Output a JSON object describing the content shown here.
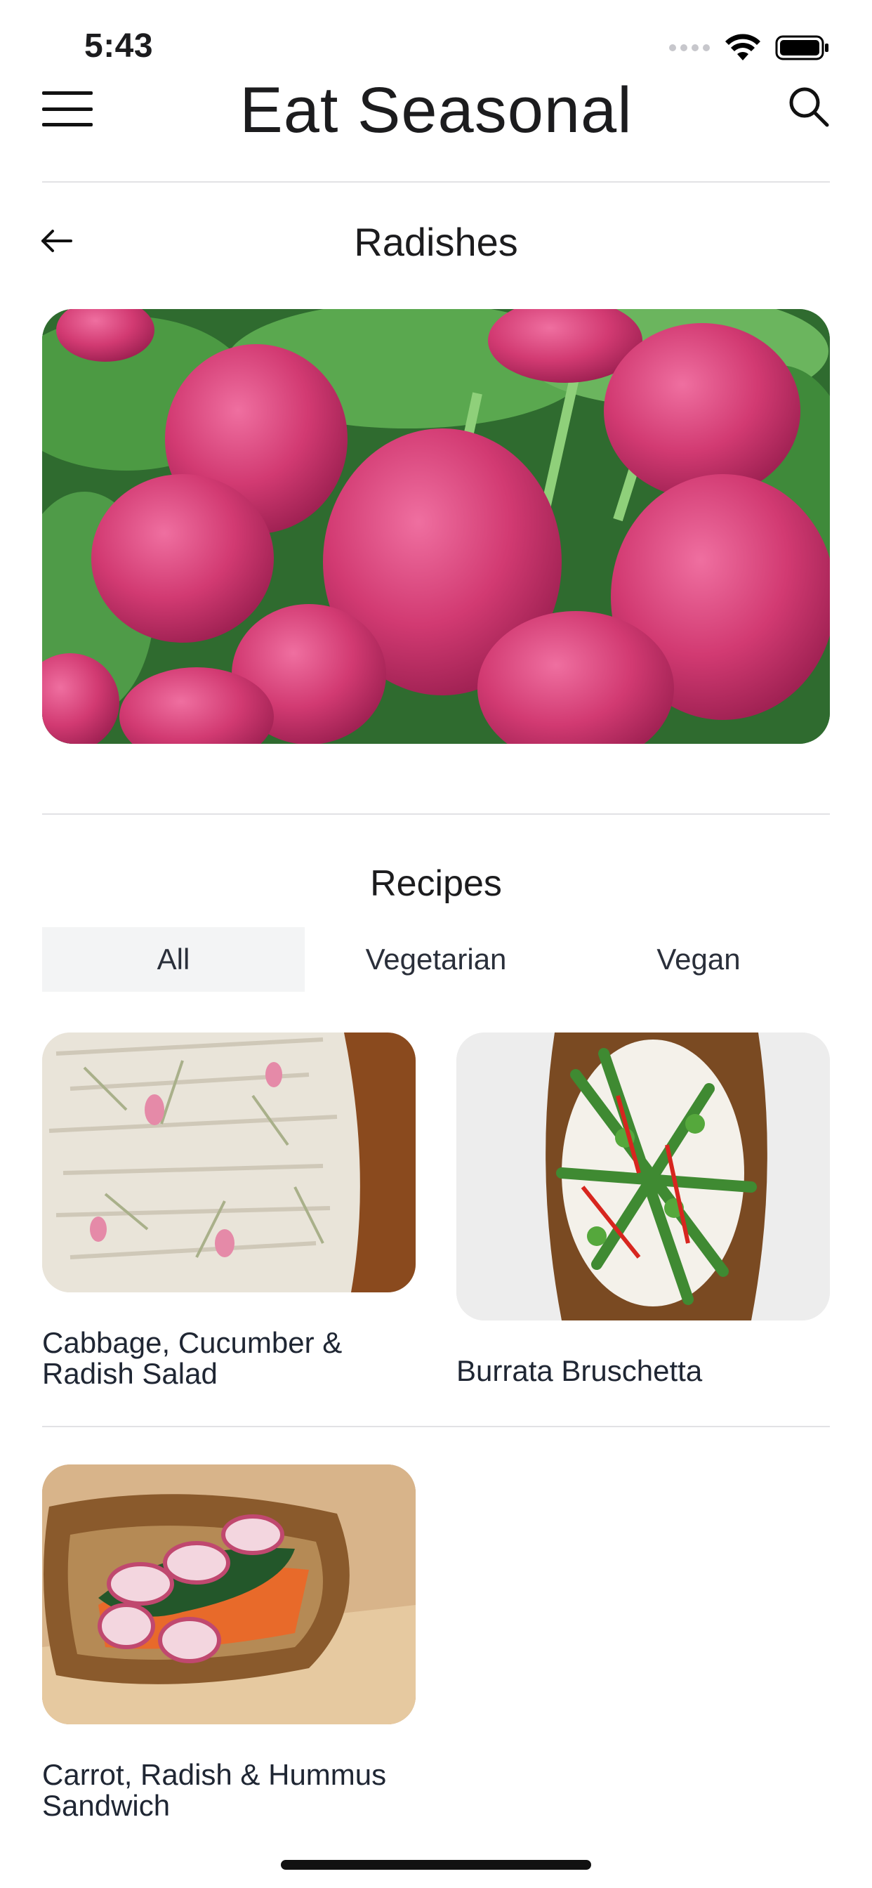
{
  "status_bar": {
    "time": "5:43"
  },
  "header": {
    "title": "Eat Seasonal"
  },
  "page": {
    "title": "Radishes"
  },
  "recipes_section": {
    "title": "Recipes",
    "tabs": [
      {
        "label": "All",
        "active": true
      },
      {
        "label": "Vegetarian",
        "active": false
      },
      {
        "label": "Vegan",
        "active": false
      }
    ],
    "items": [
      {
        "title_line1": "Cabbage, Cucumber &",
        "title_line2": "Radish Salad"
      },
      {
        "title_line1": "Burrata Bruschetta",
        "title_line2": ""
      },
      {
        "title_line1": "Carrot, Radish & Hummus",
        "title_line2": "Sandwich"
      }
    ]
  },
  "icons": {
    "menu": "hamburger-menu-icon",
    "search": "search-icon",
    "back": "arrow-left-icon"
  },
  "colors": {
    "background": "#ffffff",
    "divider": "#e2e2e5",
    "active_tab_bg": "#f3f4f5",
    "radish": "#d23a72",
    "leaf": "#3f7a3a"
  }
}
